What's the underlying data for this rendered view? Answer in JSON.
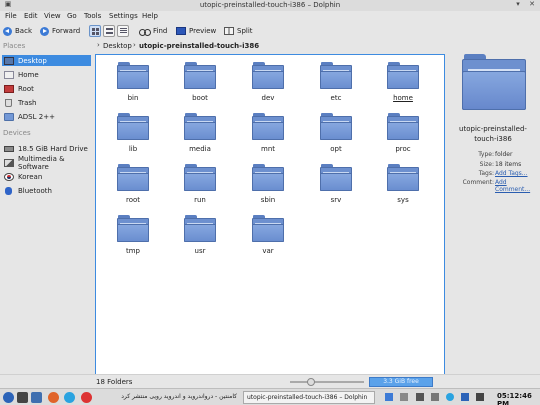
{
  "window": {
    "title": "utopic-preinstalled-touch-i386 – Dolphin"
  },
  "menubar": [
    "File",
    "Edit",
    "View",
    "Go",
    "Tools",
    "Settings",
    "Help"
  ],
  "toolbar": {
    "back": "Back",
    "forward": "Forward",
    "find": "Find",
    "preview": "Preview",
    "split": "Split"
  },
  "places": {
    "places_title": "Places",
    "items": [
      "Desktop",
      "Home",
      "Root",
      "Trash",
      "ADSL 2++"
    ],
    "devices_title": "Devices",
    "devices": [
      "18.5 GiB Hard Drive",
      "Multimedia & Software",
      "Korean",
      "Bluetooth"
    ]
  },
  "breadcrumb": [
    "Desktop",
    "utopic-preinstalled-touch-i386"
  ],
  "folders": [
    "bin",
    "boot",
    "dev",
    "etc",
    "home",
    "lib",
    "media",
    "mnt",
    "opt",
    "proc",
    "root",
    "run",
    "sbin",
    "srv",
    "sys",
    "tmp",
    "usr",
    "var"
  ],
  "info": {
    "title": "utopic-preinstalled-touch-i386",
    "type_label": "Type:",
    "type_value": "folder",
    "size_label": "Size:",
    "size_value": "18 items",
    "tags_label": "Tags:",
    "tags_value": "Add Tags...",
    "comment_label": "Comment:",
    "comment_value": "Add Comment..."
  },
  "status": {
    "text": "18 Folders",
    "free_space": "3.3 GiB free",
    "zoom_level": 0.25
  },
  "taskbar": {
    "task_browser": "کامنتین - درواندروید و اندروید رویی منتشر کرد",
    "task_dolphin": "utopic-preinstalled-touch-i386 – Dolphin",
    "clock": "05:12:46 PM"
  },
  "colors": {
    "selection": "#3d8be0",
    "folder": "#6d90cf",
    "link": "#2a5db0"
  }
}
